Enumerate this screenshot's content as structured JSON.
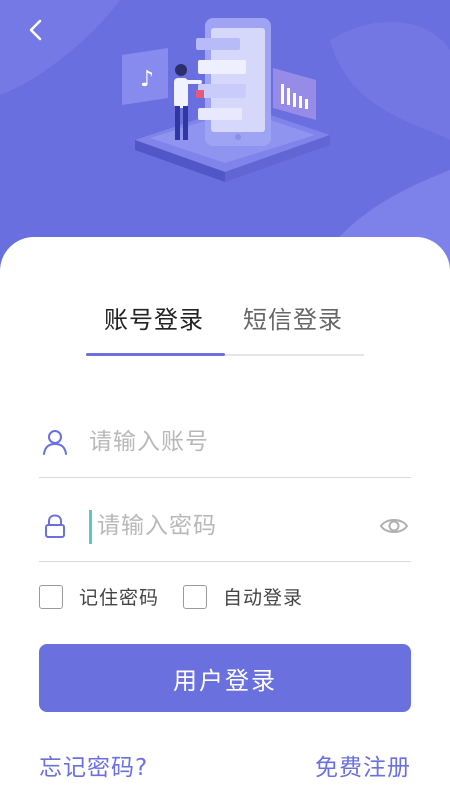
{
  "header": {
    "back_icon": "chevron-left-icon"
  },
  "tabs": [
    {
      "label": "账号登录",
      "active": true
    },
    {
      "label": "短信登录",
      "active": false
    }
  ],
  "form": {
    "account": {
      "placeholder": "请输入账号",
      "value": "",
      "icon": "user-icon"
    },
    "password": {
      "placeholder": "请输入密码",
      "value": "",
      "icon": "lock-icon",
      "toggle_icon": "eye-icon"
    },
    "remember_label": "记住密码",
    "auto_login_label": "自动登录",
    "submit_label": "用户登录"
  },
  "links": {
    "forgot": "忘记密码?",
    "register": "免费注册"
  },
  "colors": {
    "accent": "#6b70df",
    "hero_bg": "#6a6fe0",
    "caret": "#5cc7b8"
  }
}
